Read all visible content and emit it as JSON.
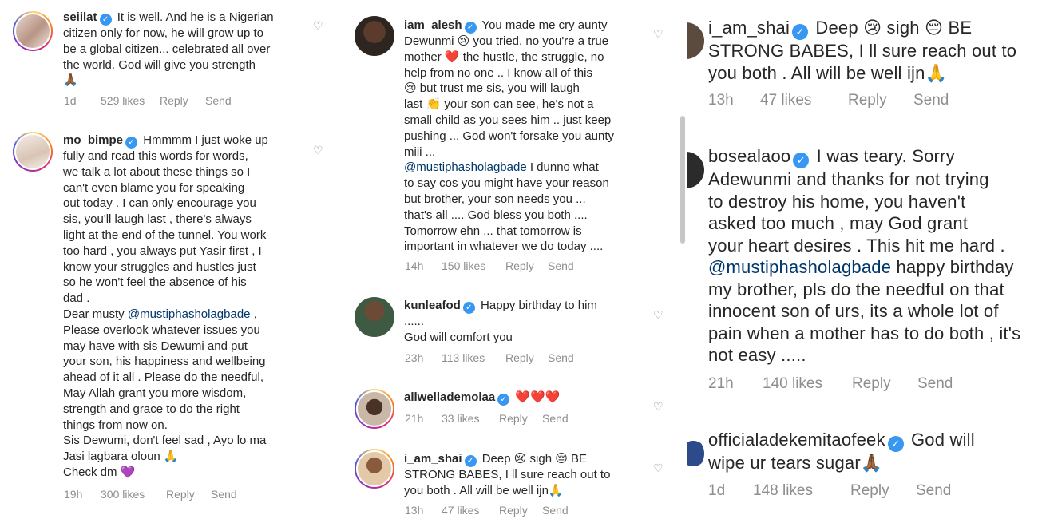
{
  "left": {
    "comments": [
      {
        "username": "seiilat",
        "text": "It is well. And he is a Nigerian\ncitizen only for now, he will grow up to\nbe a global citizen... celebrated all over\nthe world. God will give you strength\n🙏🏾",
        "time": "1d",
        "likes": "529 likes",
        "reply": "Reply",
        "send": "Send"
      },
      {
        "username": "mo_bimpe",
        "text": "Hmmmm I just woke up\nfully and read this words for words,\nwe talk a lot about these things so I\ncan't even blame you for speaking\nout today . I can only encourage you\nsis, you'll laugh last , there's always\nlight at the end of the tunnel. You work\ntoo hard , you always put Yasir first , I\nknow your struggles and hustles just\nso he won't feel the absence of his\ndad .\nDear musty ",
        "mention": "@mustiphasholagbade",
        "text2": " ,\nPlease overlook whatever issues you\nmay have with sis Dewumi and put\nyour son, his happiness and wellbeing\nahead of it all . Please do the needful,\nMay Allah grant you more wisdom,\nstrength and grace to do the right\nthings from now on.\nSis Dewumi, don't feel sad , Ayo lo ma\nJasi lagbara oloun 🙏\nCheck dm 💜",
        "time": "19h",
        "likes": "300 likes",
        "reply": "Reply",
        "send": "Send"
      }
    ]
  },
  "mid": {
    "comments": [
      {
        "username": "iam_alesh",
        "text": "You made me cry aunty\nDewunmi 😢 you tried, no you're a true\nmother ❤️ the hustle, the struggle, no\nhelp from no one .. I know all of this\n😢 but trust me sis, you will laugh\nlast 👏 your son can see, he's not a\nsmall child as you sees him .. just keep\npushing ... God won't forsake you aunty\nmiii ...\n",
        "mention": "@mustiphasholagbade",
        "text2": " I dunno what\nto say cos you might have your reason\nbut brother, your son needs you ...\nthat's all .... God bless you both ....\nTomorrow ehn ... that tomorrow is\nimportant in whatever we do today ....",
        "time": "14h",
        "likes": "150 likes",
        "reply": "Reply",
        "send": "Send"
      },
      {
        "username": "kunleafod",
        "text": "Happy birthday to him\n......\nGod will comfort you",
        "time": "23h",
        "likes": "113 likes",
        "reply": "Reply",
        "send": "Send"
      },
      {
        "username": "allwellademolaa",
        "text": "❤️❤️❤️",
        "time": "21h",
        "likes": "33 likes",
        "reply": "Reply",
        "send": "Send"
      },
      {
        "username": "i_am_shai",
        "text": "Deep 😢 sigh 😔 BE\nSTRONG BABES, I ll sure reach out to\nyou both . All will be well ijn🙏",
        "time": "13h",
        "likes": "47 likes",
        "reply": "Reply",
        "send": "Send"
      }
    ]
  },
  "right": {
    "comments": [
      {
        "username": "i_am_shai",
        "text": "Deep 😢 sigh 😔 BE\nSTRONG BABES, I ll sure reach out to\nyou both . All will be well ijn🙏",
        "time": "13h",
        "likes": "47 likes",
        "reply": "Reply",
        "send": "Send"
      },
      {
        "username": "bosealaoo",
        "text": "I was teary. Sorry\nAdewunmi and thanks for not trying\nto destroy his home, you haven't\nasked too much , may God grant\nyour heart desires . This hit me hard .\n",
        "mention": "@mustiphasholagbade",
        "text2": " happy birthday\nmy brother, pls do the needful on that\ninnocent son of urs, its a whole lot of\npain when a mother has to do both , it's\nnot easy .....",
        "time": "21h",
        "likes": "140 likes",
        "reply": "Reply",
        "send": "Send"
      },
      {
        "username": "officialadekemitaofeek",
        "text": "God will\nwipe ur tears sugar🙏🏾",
        "time": "1d",
        "likes": "148 likes",
        "reply": "Reply",
        "send": "Send"
      }
    ]
  },
  "icons": {
    "verified": "verified-badge-icon",
    "like": "heart-outline-icon"
  },
  "colors": {
    "verified": "#3897f0",
    "mention": "#00376b",
    "meta": "#8e8e8e"
  }
}
